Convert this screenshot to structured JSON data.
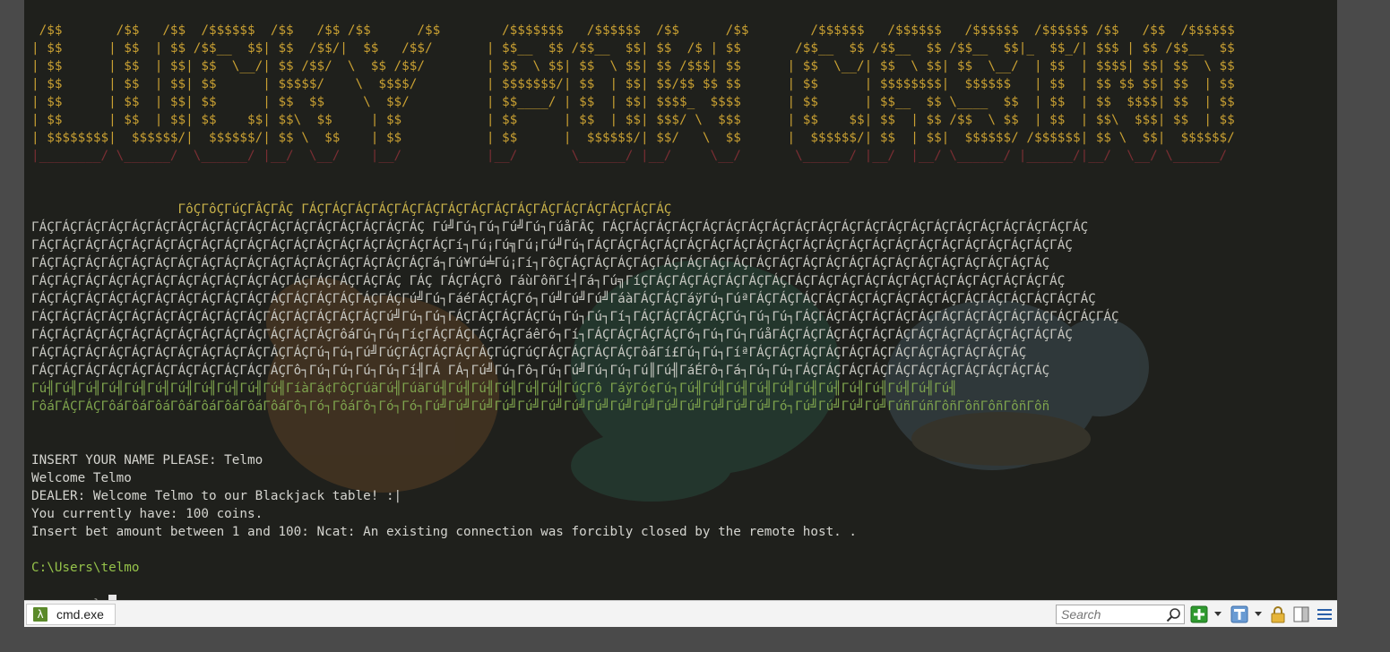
{
  "window": {
    "tab_title": "cmd.exe"
  },
  "banner": {
    "rows": [
      " /$$       /$$   /$$  /$$$$$$  /$$   /$$ /$$      /$$        /$$$$$$$   /$$$$$$  /$$      /$$        /$$$$$$   /$$$$$$   /$$$$$$  /$$$$$$ /$$   /$$  /$$$$$$",
      "| $$      | $$  | $$ /$$__  $$| $$  /$$/|  $$   /$$/       | $$__  $$ /$$__  $$| $$  /$ | $$       /$$__  $$ /$$__  $$ /$$__  $$|_  $$_/| $$$ | $$ /$$__  $$",
      "| $$      | $$  | $$| $$  \\__/| $$ /$$/  \\  $$ /$$/        | $$  \\ $$| $$  \\ $$| $$ /$$$| $$      | $$  \\__/| $$  \\ $$| $$  \\__/  | $$  | $$$$| $$| $$  \\ $$",
      "| $$      | $$  | $$| $$      | $$$$$/    \\  $$$$/         | $$$$$$$/| $$  | $$| $$/$$ $$ $$      | $$      | $$$$$$$$|  $$$$$$   | $$  | $$ $$ $$| $$  | $$",
      "| $$      | $$  | $$| $$      | $$  $$     \\  $$/          | $$____/ | $$  | $$| $$$$_  $$$$      | $$      | $$__  $$ \\____  $$  | $$  | $$  $$$$| $$  | $$",
      "| $$      | $$  | $$| $$    $$| $$\\  $$     | $$           | $$      | $$  | $$| $$$/ \\  $$$      | $$    $$| $$  | $$ /$$  \\ $$  | $$  | $$\\  $$$| $$  | $$",
      "| $$$$$$$$|  $$$$$$/|  $$$$$$/| $$ \\  $$    | $$           | $$      |  $$$$$$/| $$/   \\  $$      |  $$$$$$/| $$  | $$|  $$$$$$/ /$$$$$$| $$ \\  $$|  $$$$$$/",
      "|________/ \\______/  \\______/ |__/  \\__/    |__/           |__/       \\______/ |__/     \\__/       \\______/ |__/  |__/ \\______/ |______/|__/  \\__/ \\______/"
    ]
  },
  "art": {
    "rows": [
      "                   ΓôÇΓôÇΓúÇΓÂÇΓÂÇ ΓÁÇΓÁÇΓÁÇΓÁÇΓÁÇΓÁÇΓÁÇΓÁÇΓÁÇΓÁÇΓÁÇΓÁÇΓÁÇΓÁÇΓÁÇΓÁÇ",
      "ΓÁÇΓÁÇΓÁÇΓÁÇΓÁÇΓÁÇΓÁÇΓÁÇΓÁÇΓÁÇΓÁÇΓÁÇΓÁÇΓÁÇΓÁÇΓÁÇΓÁÇ Γú╝Γú┐Γú┐Γú╝Γú┐ΓúåΓÂÇ ΓÁÇΓÁÇΓÁÇΓÁÇΓÁÇΓÁÇΓÁÇΓÁÇΓÁÇΓÁÇΓÁÇΓÁÇΓÁÇΓÁÇΓÁÇΓÁÇΓÁÇΓÁÇΓÁÇΓÁÇΓÁÇ",
      "ΓÁÇΓÁÇΓÁÇΓÁÇΓÁÇΓÁÇΓÁÇΓÁÇΓÁÇΓÁÇΓÁÇΓÁÇΓÁÇΓÁÇΓÁÇΓÁÇΓÁÇΓÁÇΓí┐Γú¡Γú╗Γú¡Γú╜Γú┐ΓÁÇΓÁÇΓÁÇΓÁÇΓÁÇΓÁÇΓÁÇΓÁÇΓÁÇΓÁÇΓÁÇΓÁÇΓÁÇΓÁÇΓÁÇΓÁÇΓÁÇΓÁÇΓÁÇΓÁÇΓÁÇ",
      "ΓÁÇΓÁÇΓÁÇΓÁÇΓÁÇΓÁÇΓÁÇΓÁÇΓÁÇΓÁÇΓÁÇΓÁÇΓÁÇΓÁÇΓÁÇΓÁÇΓÁÇΓá┐Γú¥Γú╧Γú¡Γí┐ΓôÇΓÁÇΓÁÇΓÁÇΓÁÇΓÁÇΓÁÇΓÁÇΓÁÇΓÁÇΓÁÇΓÁÇΓÁÇΓÁÇΓÁÇΓÁÇΓÁÇΓÁÇΓÁÇΓÁÇΓÁÇΓÁÇ",
      "ΓÁÇΓÁÇΓÁÇΓÁÇΓÁÇΓÁÇΓÁÇΓÁÇΓÁÇΓÁÇΓÁÇΓÁÇΓÁÇΓÁÇΓÁÇΓÁÇ ΓÁÇ ΓÁÇΓÁÇΓô ΓáùΓôñΓí┤Γá┐Γú╗ΓíÇΓÁÇΓÁÇΓÁÇΓÁÇΓÁÇΓÁÇΓÁÇΓÁÇΓÁÇΓÁÇΓÁÇΓÁÇΓÁÇΓÁÇΓÁÇΓÁÇΓÁÇΓÁÇ",
      "ΓÁÇΓÁÇΓÁÇΓÁÇΓÁÇΓÁÇΓÁÇΓÁÇΓÁÇΓÁÇΓÁÇΓÁÇΓÁÇΓÁÇΓÁÇΓÁÇΓú╝Γú┐ΓáéΓÁÇΓÁÇΓó┐Γú╝Γú╝Γú╝ΓáàΓÁÇΓÁÇΓáÿΓú┐ΓúªΓÁÇΓÁÇΓÁÇΓÁÇΓÁÇΓÁÇΓÁÇΓÁÇΓÁÇΓÁÇΓÁÇΓÁÇΓÁÇΓÁÇΓÁÇ",
      "ΓÁÇΓÁÇΓÁÇΓÁÇΓÁÇΓÁÇΓÁÇΓÁÇΓÁÇΓÁÇΓÁÇΓÁÇΓÁÇΓÁÇΓÁÇΓú╝Γú┐Γú┐ΓÁÇΓÁÇΓÁÇΓÁÇΓú┐Γú┐Γú┐Γí┐ΓÁÇΓÁÇΓÁÇΓÁÇΓú┐Γú┐Γú┐ΓÁÇΓÁÇΓÁÇΓÁÇΓÁÇΓÁÇΓÁÇΓÁÇΓÁÇΓÁÇΓÁÇΓÁÇΓÁÇΓÁÇ",
      "ΓÁÇΓÁÇΓÁÇΓÁÇΓÁÇΓÁÇΓÁÇΓÁÇΓÁÇΓÁÇΓÁÇΓÁÇΓÁÇΓôáΓú┐Γú┐ΓíçΓÁÇΓÁÇΓÁÇΓÁÇΓáêΓó┐Γí┐ΓÁÇΓÁÇΓÁÇΓÁÇΓó┐Γú┐Γú┐ΓúåΓÁÇΓÁÇΓÁÇΓÁÇΓÁÇΓÁÇΓÁÇΓÁÇΓÁÇΓÁÇΓÁÇΓÁÇΓÁÇ",
      "ΓÁÇΓÁÇΓÁÇΓÁÇΓÁÇΓÁÇΓÁÇΓÁÇΓÁÇΓÁÇΓÁÇΓÁÇΓú┐Γú┐Γú╝ΓúÇΓÁÇΓÁÇΓÁÇΓÁÇΓúÇΓúÇΓÁÇΓÁÇΓÁÇΓÁÇΓôáΓí£Γú┐Γú┐ΓíªΓÁÇΓÁÇΓÁÇΓÁÇΓÁÇΓÁÇΓÁÇΓÁÇΓÁÇΓÁÇΓÁÇΓÁÇ",
      "ΓÁÇΓÁÇΓÁÇΓÁÇΓÁÇΓÁÇΓÁÇΓÁÇΓÁÇΓÁÇΓÁÇΓô┐Γú┐Γú┐Γú┐Γú┐Γí╢ΓÁ ΓÁ┐Γú╝Γú┐Γô┐Γú┐Γú╝Γú┐Γú┐Γú║Γú╢ΓáÉΓô┐Γá┐Γú┐Γú┐ΓÁÇΓÁÇΓÁÇΓÁÇΓÁÇΓÁÇΓÁÇΓÁÇΓÁÇΓÁÇΓÁÇ",
      "Γú╢Γú╢Γú╢Γú╢Γú╢Γú╢Γú╢Γú╢Γú╢Γú╢Γú╢ΓíàΓá¢ΓôÇΓúäΓú╢ΓúäΓú╢Γú╢Γú╢Γú╢Γú╢Γú╢ΓúÇΓô ΓáÿΓó¢Γú┐Γú╢Γú╢Γú╢Γú╢Γú╢Γú╢Γú╢Γú╢Γú╢Γú╢Γú╢Γú╢",
      "ΓôáΓÁÇΓÁÇΓôáΓôáΓôáΓôáΓôáΓôáΓôáΓôáΓô┐Γó┐ΓôáΓô┐Γó┐Γó┐Γú╝Γú╝Γú╝Γú╝Γú╝Γú╝Γú╝Γú╝Γú╝Γú╝Γú╝Γú╝Γú╝Γú╝Γú╝Γó┐Γú╝Γú╝Γú╝Γú╝ΓúñΓúñΓôñΓôñΓôñΓôñΓôñ"
    ]
  },
  "console": {
    "lines": [
      "INSERT YOUR NAME PLEASE: Telmo",
      "Welcome Telmo",
      "DEALER: Welcome Telmo to our Blackjack table! :|",
      "You currently have: 100 coins.",
      "Insert bet amount between 1 and 100: Ncat: An existing connection was forcibly closed by the remote host. ."
    ],
    "prompt_path": "C:\\Users\\telmo",
    "prompt_symbol": "λ"
  },
  "statusbar": {
    "search_placeholder": "Search",
    "tab_icon_glyph": "λ"
  },
  "colors": {
    "terminal_bg": "#1f201c",
    "banner_text": "#c9a032",
    "banner_ghost": "#7a2e33",
    "art_text": "#c7c7c1",
    "art_green": "#7ea34d",
    "prompt_path": "#95c24a"
  },
  "icons": [
    "search-icon",
    "add-tab-icon",
    "split-icon",
    "lock-icon",
    "panes-icon",
    "menu-icon",
    "lambda-icon"
  ]
}
